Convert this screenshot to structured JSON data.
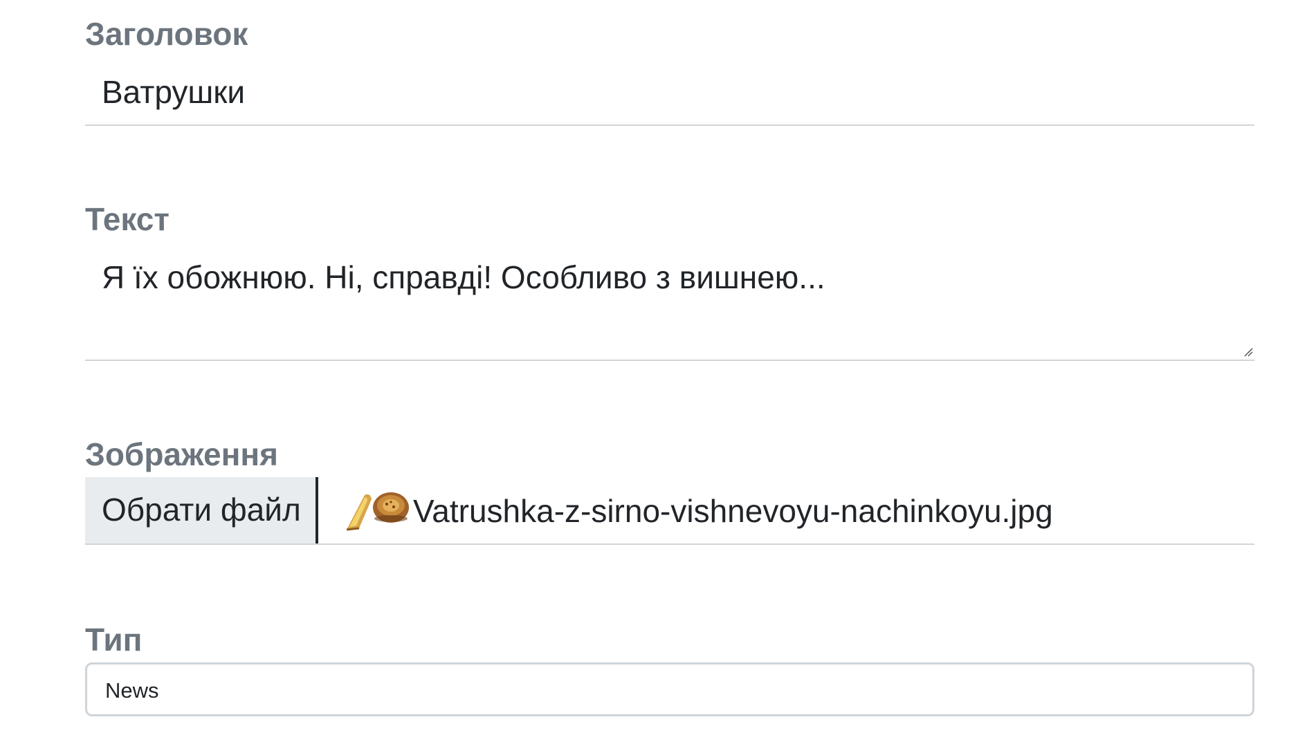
{
  "form": {
    "title": {
      "label": "Заголовок",
      "value": "Ватрушки"
    },
    "text": {
      "label": "Текст",
      "value": "Я їх обожнюю. Ні, справді! Особливо з вишнею..."
    },
    "image": {
      "label": "Зображення",
      "button_label": "Обрати файл",
      "file_icon": "pastry-thumbnail-icon",
      "file_name": "Vatrushka-z-sirno-vishnevoyu-nachinkoyu.jpg"
    },
    "type": {
      "label": "Тип",
      "selected": "News"
    }
  },
  "colors": {
    "label": "#6c757d",
    "text": "#212529",
    "button_bg": "#e9ecef",
    "border": "#ced4da"
  }
}
